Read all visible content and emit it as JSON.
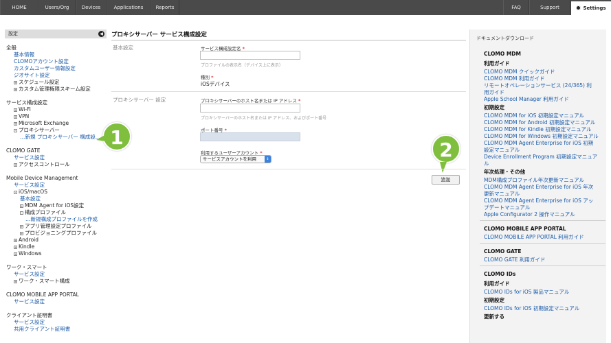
{
  "topnav": {
    "items": [
      "HOME",
      "Users/Org",
      "Devices",
      "Applications",
      "Reports",
      "FAQ",
      "Support"
    ],
    "settings_label": "Settings"
  },
  "sidebar": {
    "header": "設定",
    "rows": [
      {
        "text": "全般",
        "kind": "sec",
        "indent": 0
      },
      {
        "text": "基本情報",
        "kind": "link",
        "indent": 1
      },
      {
        "text": "CLOMOアカウント設定",
        "kind": "link",
        "indent": 1
      },
      {
        "text": "カスタムユーザー情報設定",
        "kind": "link",
        "indent": 1
      },
      {
        "text": "ジオサイト設定",
        "kind": "link",
        "indent": 1
      },
      {
        "text": "スケジュール設定",
        "kind": "txt",
        "indent": 1,
        "box": "+"
      },
      {
        "text": "カスタム管理権限スキーム設定",
        "kind": "txt",
        "indent": 1,
        "box": "+"
      },
      {
        "text": "",
        "kind": "gap"
      },
      {
        "text": "サービス構成設定",
        "kind": "sec",
        "indent": 0
      },
      {
        "text": "Wi-Fi",
        "kind": "txt",
        "indent": 1,
        "box": "+"
      },
      {
        "text": "VPN",
        "kind": "txt",
        "indent": 1,
        "box": "+"
      },
      {
        "text": "Microsoft Exchange",
        "kind": "txt",
        "indent": 1,
        "box": "+"
      },
      {
        "text": "プロキシサーバー",
        "kind": "txt",
        "indent": 1,
        "box": "-"
      },
      {
        "text": "…新規 プロキシサーバー 構成設...",
        "kind": "link",
        "indent": 2
      },
      {
        "text": "",
        "kind": "gap"
      },
      {
        "text": "CLOMO GATE",
        "kind": "sec",
        "indent": 0
      },
      {
        "text": "サービス設定",
        "kind": "link",
        "indent": 1
      },
      {
        "text": "アクセスコントロール",
        "kind": "txt",
        "indent": 1,
        "box": "+"
      },
      {
        "text": "",
        "kind": "gap"
      },
      {
        "text": "Mobile Device Management",
        "kind": "sec",
        "indent": 0
      },
      {
        "text": "サービス設定",
        "kind": "link",
        "indent": 1
      },
      {
        "text": "iOS/macOS",
        "kind": "txt",
        "indent": 1,
        "box": "-"
      },
      {
        "text": "基本設定",
        "kind": "link",
        "indent": 2
      },
      {
        "text": "MDM Agent for iOS設定",
        "kind": "txt",
        "indent": 2,
        "box": "+"
      },
      {
        "text": "構成プロファイル",
        "kind": "txt",
        "indent": 2,
        "box": "-"
      },
      {
        "text": "…新規構成プロファイルを作成",
        "kind": "link",
        "indent": 3
      },
      {
        "text": "アプリ管理設定プロファイル",
        "kind": "txt",
        "indent": 2,
        "box": "+"
      },
      {
        "text": "プロビジョニングプロファイル",
        "kind": "txt",
        "indent": 2,
        "box": "+"
      },
      {
        "text": "Android",
        "kind": "txt",
        "indent": 1,
        "box": "+"
      },
      {
        "text": "Kindle",
        "kind": "txt",
        "indent": 1,
        "box": "+"
      },
      {
        "text": "Windows",
        "kind": "txt",
        "indent": 1,
        "box": "+"
      },
      {
        "text": "",
        "kind": "gap"
      },
      {
        "text": "ワーク・スマート",
        "kind": "sec",
        "indent": 0
      },
      {
        "text": "サービス設定",
        "kind": "link",
        "indent": 1
      },
      {
        "text": "ワーク・スマート構成",
        "kind": "txt",
        "indent": 1,
        "box": "+"
      },
      {
        "text": "",
        "kind": "gap"
      },
      {
        "text": "CLOMO MOBILE APP PORTAL",
        "kind": "sec",
        "indent": 0
      },
      {
        "text": "サービス設定",
        "kind": "link",
        "indent": 1
      },
      {
        "text": "",
        "kind": "gap"
      },
      {
        "text": "クライアント証明書",
        "kind": "sec",
        "indent": 0
      },
      {
        "text": "サービス設定",
        "kind": "link",
        "indent": 1
      },
      {
        "text": "共用クライアント証明書",
        "kind": "link",
        "indent": 1
      }
    ]
  },
  "callouts": [
    "1",
    "2"
  ],
  "main": {
    "title": "プロキシサーバー サービス構成設定",
    "section_basic": "基本設定",
    "section_proxy": "プロキシサーバー 設定",
    "name_label": "サービス構成設定名",
    "name_help": "プロファイルの表示名（デバイス上に表示）",
    "type_label": "種別",
    "type_value": "iOSデバイス",
    "host_label": "プロキシサーバーのホスト名または IP アドレス",
    "host_help": "プロキシサーバーのホスト名または IP アドレス、およびポート番号",
    "port_label": "ポート番号",
    "account_label": "利用するユーザーアカウント",
    "account_value": "サービスアカウントを利用",
    "req_mark": "*",
    "add_button": "追加"
  },
  "rightpanel": {
    "title": "ドキュメントダウンロード",
    "rows": [
      {
        "text": "CLOMO MDM",
        "kind": "head"
      },
      {
        "text": "利用ガイド",
        "kind": "sub"
      },
      {
        "text": "CLOMO MDM クイックガイド",
        "kind": "link"
      },
      {
        "text": "CLOMO MDM 利用ガイド",
        "kind": "link"
      },
      {
        "text": "リモートオペレーションサービス (24/365) 利",
        "kind": "link"
      },
      {
        "text": "用ガイド",
        "kind": "link"
      },
      {
        "text": "Apple School Manager 利用ガイド",
        "kind": "link"
      },
      {
        "text": "初期設定",
        "kind": "sub"
      },
      {
        "text": "CLOMO MDM for iOS 初期設定マニュアル",
        "kind": "link"
      },
      {
        "text": "CLOMO MDM for Android 初期設定マニュアル",
        "kind": "link"
      },
      {
        "text": "CLOMO MDM for Kindle 初期設定マニュアル",
        "kind": "link"
      },
      {
        "text": "CLOMO MDM for Windows 初期設定マニュアル",
        "kind": "link"
      },
      {
        "text": "CLOMO MDM Agent Enterprise for iOS 初期",
        "kind": "link"
      },
      {
        "text": "設定マニュアル",
        "kind": "link"
      },
      {
        "text": "Device Enrollment Program 初期設定マニュア",
        "kind": "link"
      },
      {
        "text": "ル",
        "kind": "link"
      },
      {
        "text": "年次処理・その他",
        "kind": "sub"
      },
      {
        "text": "MDM構成プロファイル年次更新マニュアル",
        "kind": "link"
      },
      {
        "text": "CLOMO MDM Agent Enterprise for iOS 年次",
        "kind": "link"
      },
      {
        "text": "更新マニュアル",
        "kind": "link"
      },
      {
        "text": "CLOMO MDM Agent Enterprise for iOS アッ",
        "kind": "link"
      },
      {
        "text": "プデートマニュアル",
        "kind": "link"
      },
      {
        "text": "Apple Configurator 2 操作マニュアル",
        "kind": "link"
      },
      {
        "text": "",
        "kind": "div"
      },
      {
        "text": "CLOMO MOBILE APP PORTAL",
        "kind": "head"
      },
      {
        "text": "CLOMO MOBILE APP PORTAL 利用ガイド",
        "kind": "link"
      },
      {
        "text": "",
        "kind": "div"
      },
      {
        "text": "CLOMO GATE",
        "kind": "head"
      },
      {
        "text": "CLOMO GATE 利用ガイド",
        "kind": "link"
      },
      {
        "text": "",
        "kind": "div"
      },
      {
        "text": "CLOMO IDs",
        "kind": "head"
      },
      {
        "text": "利用ガイド",
        "kind": "sub"
      },
      {
        "text": "CLOMO IDs for iOS 製品マニュアル",
        "kind": "link"
      },
      {
        "text": "初期設定",
        "kind": "sub"
      },
      {
        "text": "CLOMO IDs for iOS 初期設定マニュアル",
        "kind": "link"
      },
      {
        "text": "更新する",
        "kind": "sub"
      }
    ]
  }
}
